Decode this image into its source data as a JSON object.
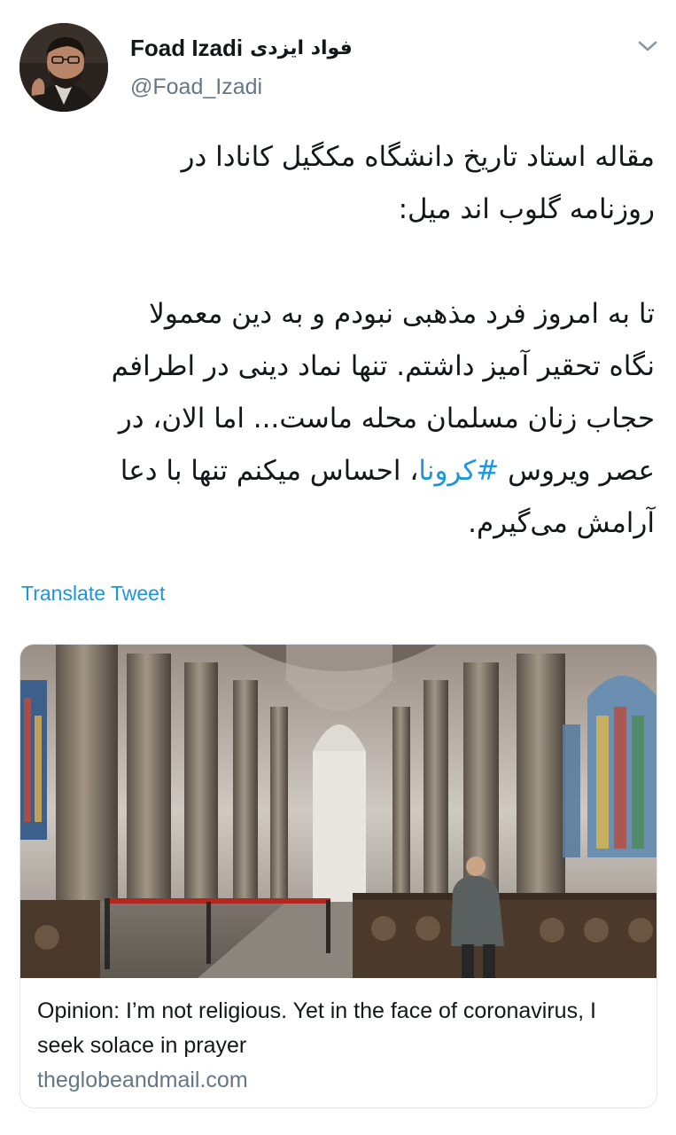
{
  "author": {
    "display_name": "Foad Izadi",
    "display_name_fa": "فواد ایزدی",
    "handle": "@Foad_Izadi",
    "avatar_icon": "person-avatar"
  },
  "tweet": {
    "intro_lines": [
      "مقاله استاد تاریخ دانشگاه مکگیل کانادا در",
      "روزنامه گلوب اند میل:"
    ],
    "body_lines": [
      "تا به امروز فرد مذهبی نبودم و به دین معمولا",
      "نگاه تحقیر آمیز داشتم. تنها نماد دینی در اطرافم",
      "حجاب زنان مسلمان محله ماست... اما الان، در"
    ],
    "line4_before": "عصر ویروس ",
    "hashtag": "#کرونا",
    "line4_after": "، احساس میکنم تنها با دعا",
    "last_line": "آرامش می‌گیرم.",
    "translate_label": "Translate Tweet",
    "menu_icon": "chevron-down-icon"
  },
  "link_card": {
    "title": "Opinion: I’m not religious. Yet in the face of coronavirus, I seek solace in prayer",
    "domain": "theglobeandmail.com",
    "image_alt": "cathedral-interior-photo"
  },
  "colors": {
    "text": "#14171a",
    "secondary": "#657786",
    "link": "#1b95e0",
    "border": "#e1e8ed"
  }
}
